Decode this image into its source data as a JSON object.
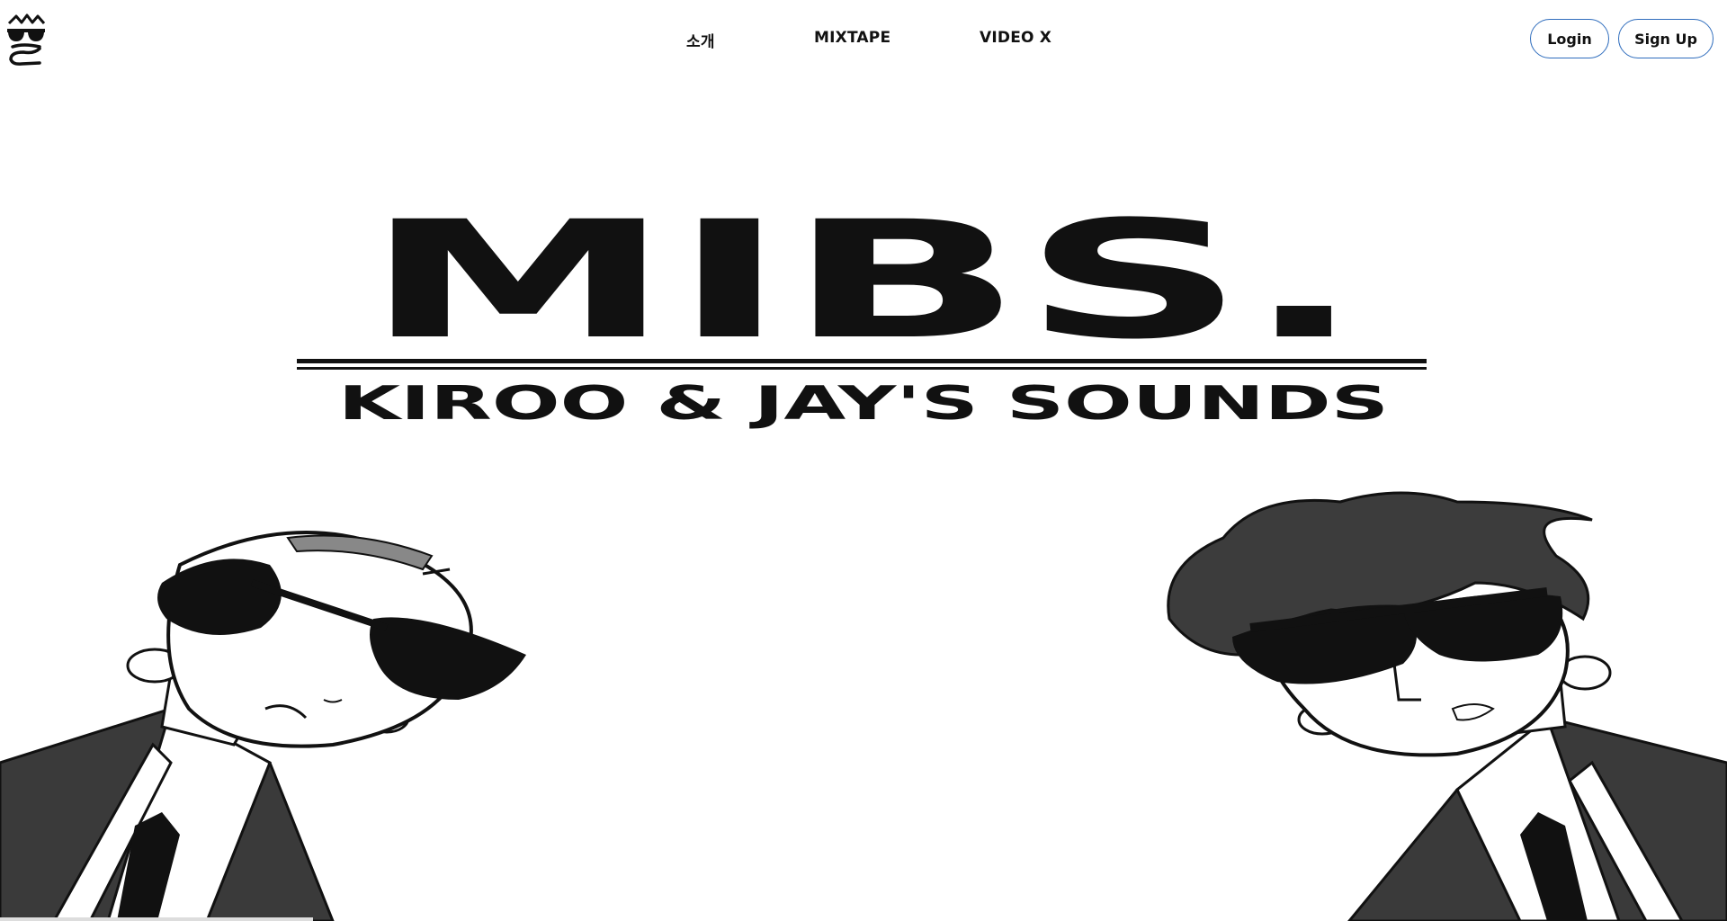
{
  "header": {
    "nav": [
      {
        "label": "소개"
      },
      {
        "label": "MIXTAPE"
      },
      {
        "label": "VIDEO X"
      }
    ],
    "login_label": "Login",
    "signup_label": "Sign Up"
  },
  "hero": {
    "title": "MIBS.",
    "subtitle": "KIROO & JAY'S SOUNDS"
  },
  "colors": {
    "button_border": "#2f6dbd",
    "ink": "#111111",
    "background": "#ffffff"
  },
  "icons": {
    "logo": "sunglasses-mustache-logo"
  }
}
